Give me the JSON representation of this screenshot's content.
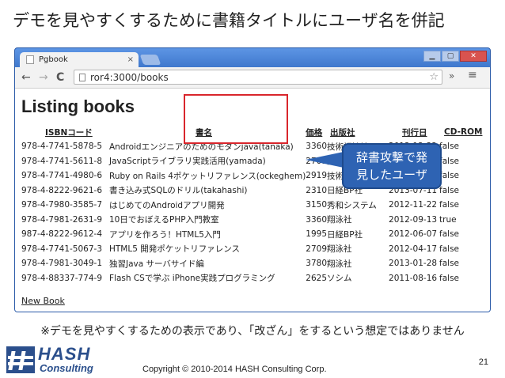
{
  "slide": {
    "title": "デモを見やすくするために書籍タイトルにユーザ名を併記",
    "note": "※デモを見やすくするための表示であり、「改ざん」をするという想定ではありません",
    "callout": "辞書攻撃で発\n見したユーザ",
    "copyright": "Copyright © 2010-2014 HASH Consulting Corp.",
    "page_number": "21",
    "logo": {
      "word": "HASH",
      "sub": "Consulting"
    },
    "colors": {
      "highlight": "#d9262c",
      "callout_bg": "#2e63b3",
      "logo": "#2b4f8c"
    }
  },
  "browser": {
    "tab_title": "Pgbook",
    "tab_close": "×",
    "url": "ror4:3000/books",
    "win_buttons": [
      "▁",
      "▢",
      "✕"
    ],
    "nav": {
      "back": "←",
      "forward": "→",
      "reload": "C"
    },
    "toolbar_right": {
      "star": "☆",
      "extend": "»",
      "menu": "≡"
    }
  },
  "page": {
    "heading": "Listing books",
    "columns": [
      "ISBNコード",
      "書名",
      "価格",
      "出版社",
      "刊行日",
      "CD-ROM"
    ],
    "rows": [
      [
        "978-4-7741-5878-5",
        "Androidエンジニアのためのモダンjava(tanaka)",
        "3360",
        "技術評論社",
        "2012-12-22",
        "false"
      ],
      [
        "978-4-7741-5611-8",
        "JavaScriptライブラリ実践活用(yamada)",
        "2709",
        "技術評論社",
        "2013-03-12",
        "false"
      ],
      [
        "978-4-7741-4980-6",
        "Ruby on Rails 4ポケットリファレンス(ockeghem)",
        "2919",
        "技術評論社",
        "2013-09-26",
        "false"
      ],
      [
        "978-4-8222-9621-6",
        "書き込み式SQLのドリル(takahashi)",
        "2310",
        "日経BP社",
        "2013-07-11",
        "false"
      ],
      [
        "978-4-7980-3585-7",
        "はじめてのAndroidアプリ開発",
        "3150",
        "秀和システム",
        "2012-11-22",
        "false"
      ],
      [
        "978-4-7981-2631-9",
        "10日でおぼえるPHP入門教室",
        "3360",
        "翔泳社",
        "2012-09-13",
        "true"
      ],
      [
        "987-4-8222-9612-4",
        "アプリを作ろう！HTML5入門",
        "1995",
        "日経BP社",
        "2012-06-07",
        "false"
      ],
      [
        "978-4-7741-5067-3",
        "HTML5 開発ポケットリファレンス",
        "2709",
        "翔泳社",
        "2012-04-17",
        "false"
      ],
      [
        "978-4-7981-3049-1",
        "独習Java サーバサイド編",
        "3780",
        "翔泳社",
        "2013-01-28",
        "false"
      ],
      [
        "978-4-88337-774-9",
        "Flash CSで学ぶ iPhone実践プログラミング",
        "2625",
        "ソシム",
        "2011-08-16",
        "false"
      ]
    ],
    "new_book_link": "New Book"
  }
}
